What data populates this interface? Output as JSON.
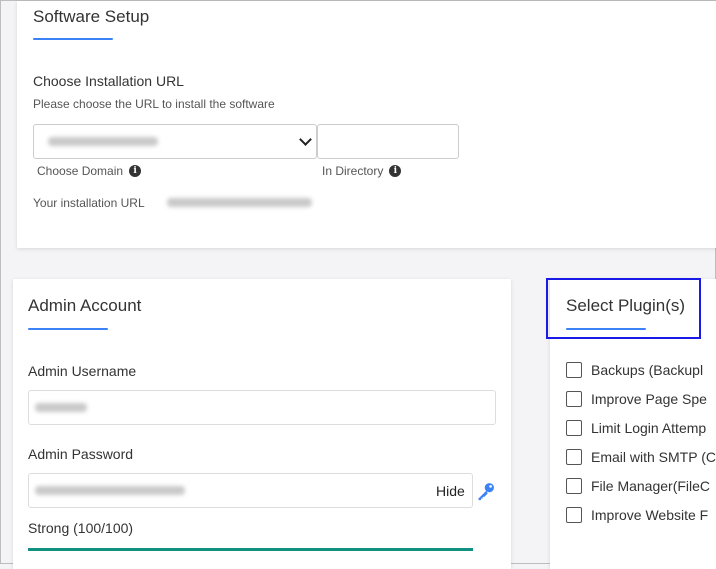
{
  "software_setup": {
    "title": "Software Setup",
    "choose_url_label": "Choose Installation URL",
    "choose_url_hint": "Please choose the URL to install the software",
    "domain_label": "Choose Domain",
    "directory_label": "In Directory",
    "installation_url_label": "Your installation URL",
    "directory_value": ""
  },
  "admin_account": {
    "title": "Admin Account",
    "username_label": "Admin Username",
    "password_label": "Admin Password",
    "hide_label": "Hide",
    "strength_text": "Strong (100/100)",
    "strength_value": 100
  },
  "plugins": {
    "title": "Select Plugin(s)",
    "items": [
      {
        "label": "Backups (Backupl",
        "checked": false
      },
      {
        "label": "Improve Page Spe",
        "checked": false
      },
      {
        "label": "Limit Login Attemp",
        "checked": false
      },
      {
        "label": "Email with SMTP (C",
        "checked": false
      },
      {
        "label": "File Manager(FileC",
        "checked": false
      },
      {
        "label": "Improve Website F",
        "checked": false
      }
    ]
  },
  "colors": {
    "accent": "#3b82f6",
    "strength": "#0f9080",
    "highlight": "#1a1ae6"
  },
  "icons": [
    "info-icon",
    "chevron-down-icon",
    "key-icon"
  ]
}
